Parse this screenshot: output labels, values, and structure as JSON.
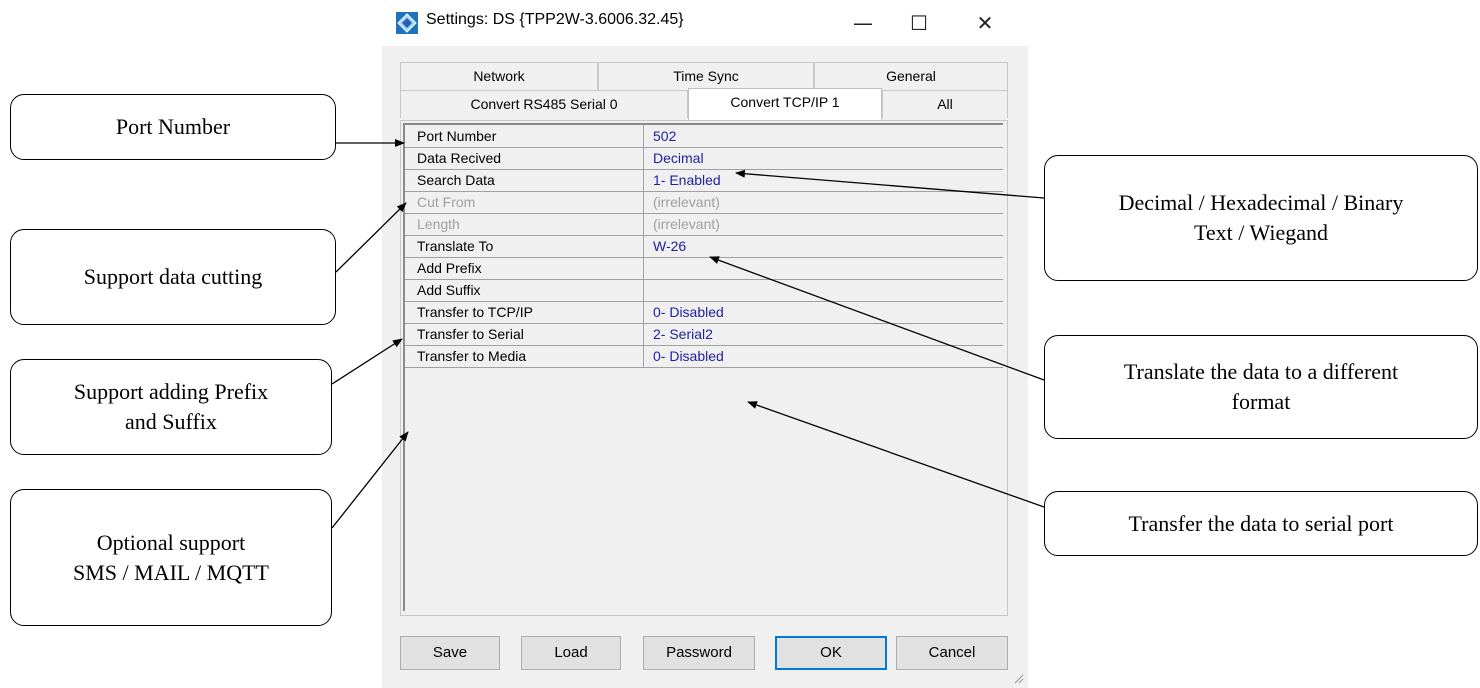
{
  "window": {
    "title": "Settings: DS {TPP2W-3.6006.32.45}",
    "controls": {
      "minimize": "—",
      "maximize": "☐",
      "close": "✕"
    }
  },
  "tabs": {
    "row1": [
      "Network",
      "Time Sync",
      "General"
    ],
    "row2": [
      "Convert RS485 Serial 0",
      "Convert TCP/IP 1",
      "All"
    ],
    "active": "Convert TCP/IP 1"
  },
  "properties": [
    {
      "name": "Port Number",
      "value": "502",
      "enabled": true
    },
    {
      "name": "Data Recived",
      "value": "Decimal",
      "enabled": true
    },
    {
      "name": "Search Data",
      "value": "1- Enabled",
      "enabled": true
    },
    {
      "name": "Cut From",
      "value": "(irrelevant)",
      "enabled": false
    },
    {
      "name": "Length",
      "value": "(irrelevant)",
      "enabled": false
    },
    {
      "name": "Translate To",
      "value": "W-26",
      "enabled": true
    },
    {
      "name": "Add Prefix",
      "value": "",
      "enabled": true
    },
    {
      "name": "Add Suffix",
      "value": "",
      "enabled": true
    },
    {
      "name": "Transfer to TCP/IP",
      "value": "0- Disabled",
      "enabled": true
    },
    {
      "name": "Transfer to Serial",
      "value": "2- Serial2",
      "enabled": true
    },
    {
      "name": "Transfer to Media",
      "value": "0- Disabled",
      "enabled": true
    }
  ],
  "buttons": {
    "save": "Save",
    "load": "Load",
    "password": "Password",
    "ok": "OK",
    "cancel": "Cancel"
  },
  "callouts": {
    "port_number": "Port Number",
    "data_cutting": "Support data cutting",
    "prefix_suffix": "Support adding Prefix\nand Suffix",
    "optional": "Optional support\nSMS / MAIL / MQTT",
    "decimal": "Decimal / Hexadecimal / Binary\nText / Wiegand",
    "translate": "Translate the data to a different\nformat",
    "transfer": "Transfer the data to serial port"
  },
  "colors": {
    "value_text": "#1f1fa0",
    "disabled_text": "#a0a0a0",
    "ok_border": "#0078d7"
  }
}
